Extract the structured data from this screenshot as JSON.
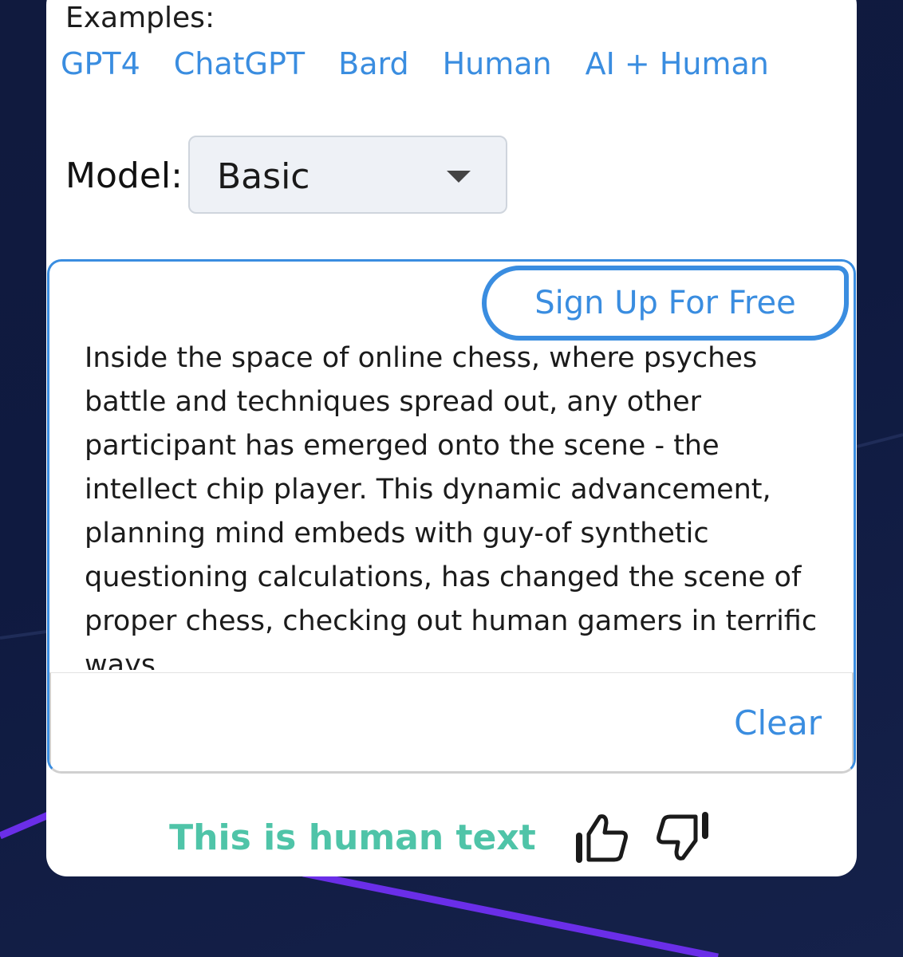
{
  "examples": {
    "label": "Examples:",
    "links": [
      "GPT4",
      "ChatGPT",
      "Bard",
      "Human",
      "AI + Human"
    ]
  },
  "model": {
    "label": "Model:",
    "selected": "Basic"
  },
  "editor": {
    "signup_label": "Sign Up For Free",
    "text": "Inside the space of online chess, where psyches battle and techniques spread out, any other participant has emerged onto the scene - the intellect chip player. This dynamic advancement, planning mind embeds with guy-of synthetic questioning calculations, has changed the scene of proper chess, checking out human gamers in terrific ways.",
    "clear_label": "Clear"
  },
  "result": {
    "text": "This is human text",
    "color": "#4fc4a8"
  },
  "icons": {
    "thumbs_up": "thumbs-up-icon",
    "thumbs_down": "thumbs-down-icon",
    "dropdown": "chevron-down-icon"
  },
  "colors": {
    "accent": "#3a8de0",
    "background": "#101a3e",
    "decor_line": "#6a2ee8"
  }
}
